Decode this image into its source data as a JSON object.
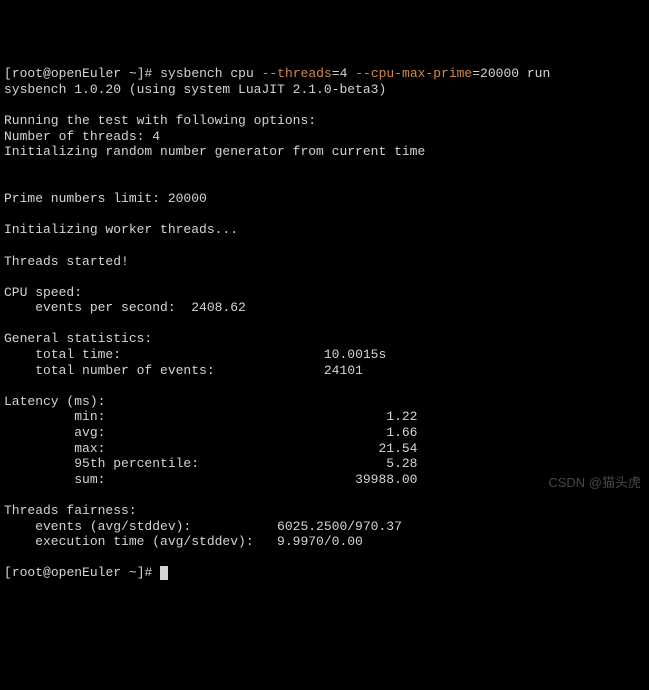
{
  "prompt": {
    "user": "root",
    "host": "openEuler",
    "dir": "~",
    "sym": "#"
  },
  "cmd": {
    "bin": "sysbench",
    "sub": "cpu",
    "opt1_flag": "--threads",
    "opt1_val": "=4",
    "opt2_flag": "--cpu-max-prime",
    "opt2_val": "=20000",
    "action": "run"
  },
  "version_line": "sysbench 1.0.20 (using system LuaJIT 2.1.0-beta3)",
  "section": {
    "running": "Running the test with following options:",
    "threads": "Number of threads: 4",
    "init_rng": "Initializing random number generator from current time",
    "prime_limit": "Prime numbers limit: 20000",
    "init_workers": "Initializing worker threads...",
    "started": "Threads started!",
    "cpu_speed_hdr": "CPU speed:",
    "eps_label": "    events per second:  ",
    "eps_value": "2408.62",
    "gen_stats_hdr": "General statistics:",
    "total_time_label": "    total time:                          ",
    "total_time_value": "10.0015s",
    "total_events_label": "    total number of events:              ",
    "total_events_value": "24101",
    "latency_hdr": "Latency (ms):",
    "lat_min_label": "         min:                                    ",
    "lat_min_value": "1.22",
    "lat_avg_label": "         avg:                                    ",
    "lat_avg_value": "1.66",
    "lat_max_label": "         max:                                   ",
    "lat_max_value": "21.54",
    "lat_p95_label": "         95th percentile:                        ",
    "lat_p95_value": "5.28",
    "lat_sum_label": "         sum:                                ",
    "lat_sum_value": "39988.00",
    "fairness_hdr": "Threads fairness:",
    "events_avg_label": "    events (avg/stddev):           ",
    "events_avg_value": "6025.2500/970.37",
    "exec_time_label": "    execution time (avg/stddev):   ",
    "exec_time_value": "9.9970/0.00"
  },
  "watermark": "CSDN @猫头虎"
}
